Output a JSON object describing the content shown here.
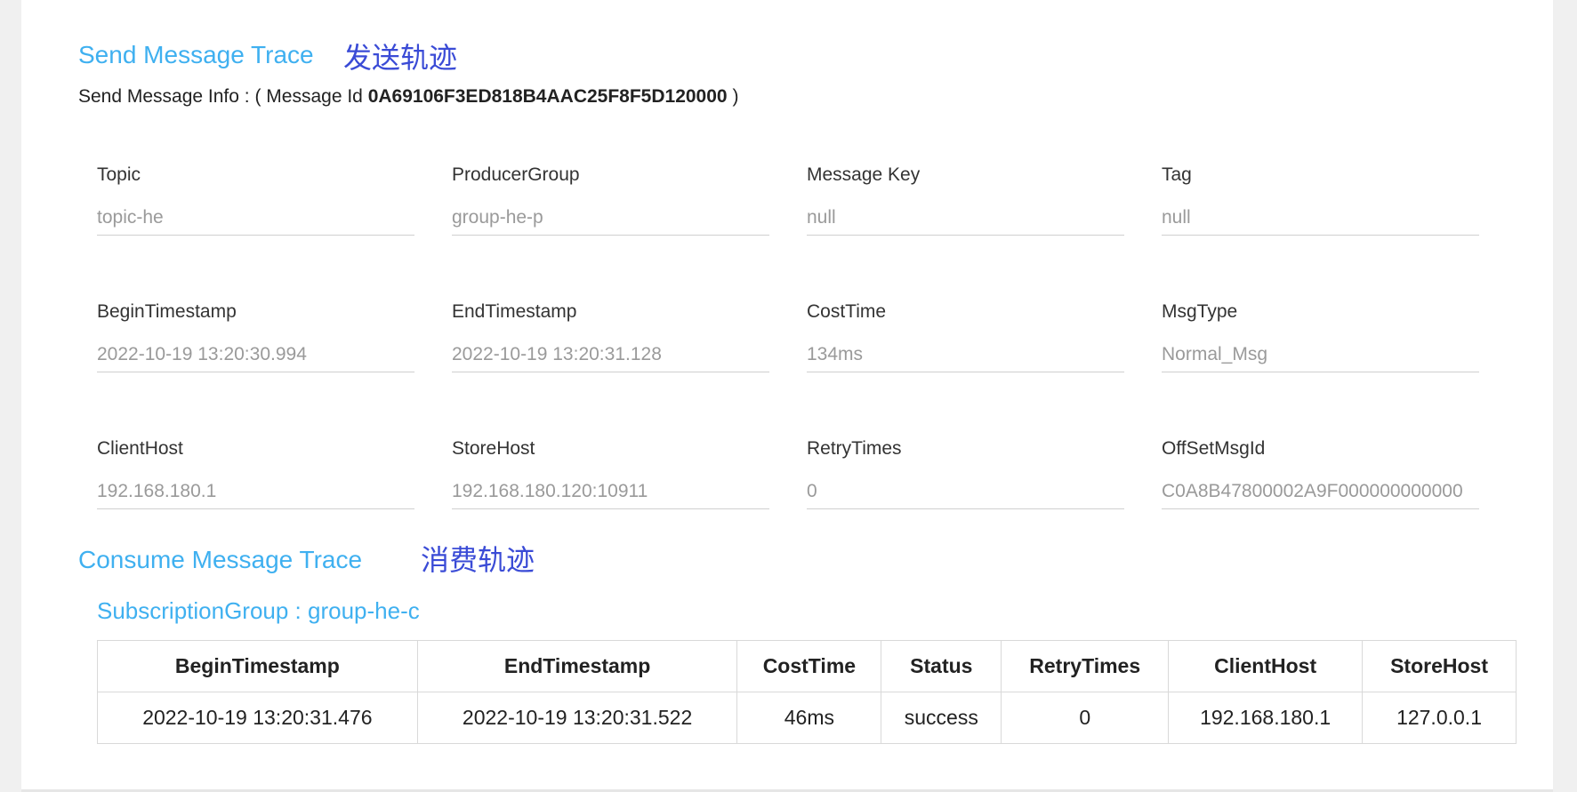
{
  "send": {
    "title": "Send Message Trace",
    "annotation": "发送轨迹",
    "info_prefix": "Send Message Info : ( Message Id",
    "message_id": "0A69106F3ED818B4AAC25F8F5D120000",
    "info_suffix": ")",
    "fields": [
      {
        "label": "Topic",
        "value": "topic-he"
      },
      {
        "label": "ProducerGroup",
        "value": "group-he-p"
      },
      {
        "label": "Message Key",
        "value": "null"
      },
      {
        "label": "Tag",
        "value": "null"
      },
      {
        "label": "BeginTimestamp",
        "value": "2022-10-19 13:20:30.994"
      },
      {
        "label": "EndTimestamp",
        "value": "2022-10-19 13:20:31.128"
      },
      {
        "label": "CostTime",
        "value": "134ms"
      },
      {
        "label": "MsgType",
        "value": "Normal_Msg"
      },
      {
        "label": "ClientHost",
        "value": "192.168.180.1"
      },
      {
        "label": "StoreHost",
        "value": "192.168.180.120:10911"
      },
      {
        "label": "RetryTimes",
        "value": "0"
      },
      {
        "label": "OffSetMsgId",
        "value": "C0A8B47800002A9F000000000000"
      }
    ]
  },
  "consume": {
    "title": "Consume Message Trace",
    "annotation": "消费轨迹",
    "subscription_group": "SubscriptionGroup : group-he-c",
    "columns": [
      "BeginTimestamp",
      "EndTimestamp",
      "CostTime",
      "Status",
      "RetryTimes",
      "ClientHost",
      "StoreHost"
    ],
    "rows": [
      [
        "2022-10-19 13:20:31.476",
        "2022-10-19 13:20:31.522",
        "46ms",
        "success",
        "0",
        "192.168.180.1",
        "127.0.0.1"
      ]
    ]
  },
  "colors": {
    "title_blue": "#3fb0f0",
    "annotation_blue": "#3a4bd6",
    "value_gray": "#9a9a9a"
  }
}
